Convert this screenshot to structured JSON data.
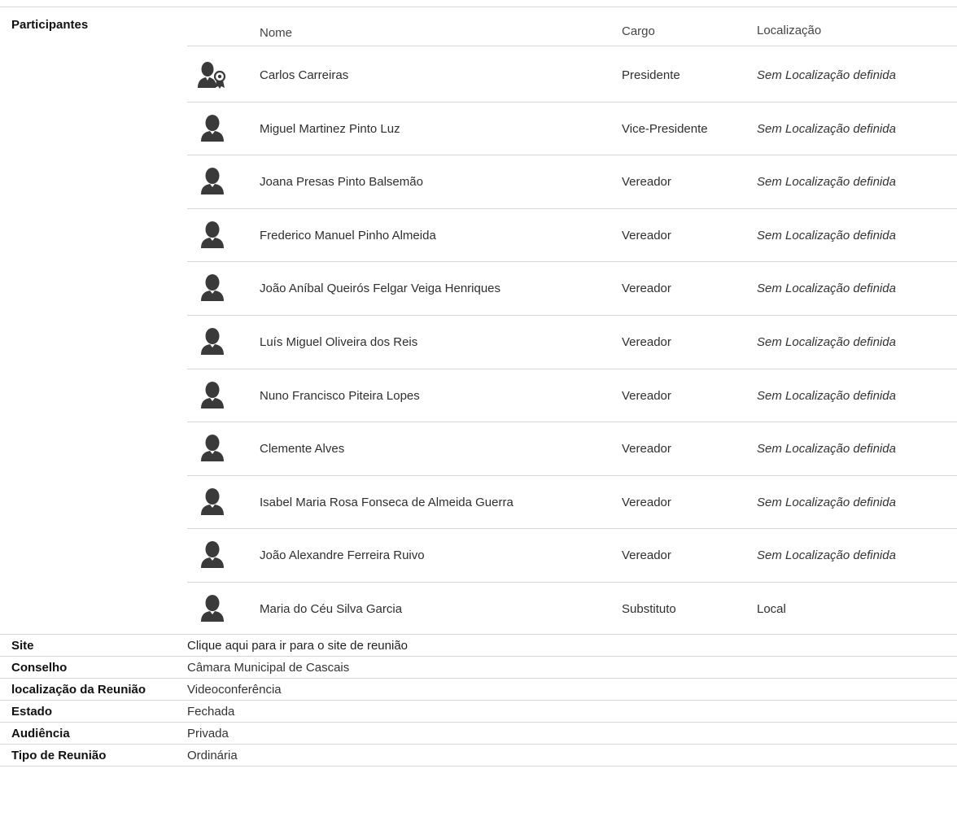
{
  "participants_section": {
    "label": "Participantes",
    "columns": {
      "name": "Nome",
      "role": "Cargo",
      "location": "Localização"
    },
    "rows": [
      {
        "name": "Carlos Carreiras",
        "role": "Presidente",
        "location": "Sem Localização definida",
        "icon": "president-icon"
      },
      {
        "name": "Miguel Martinez Pinto Luz",
        "role": "Vice-Presidente",
        "location": "Sem Localização definida",
        "icon": "person-icon"
      },
      {
        "name": "Joana Presas Pinto Balsemão",
        "role": "Vereador",
        "location": "Sem Localização definida",
        "icon": "person-icon"
      },
      {
        "name": "Frederico Manuel Pinho Almeida",
        "role": "Vereador",
        "location": "Sem Localização definida",
        "icon": "person-icon"
      },
      {
        "name": "João Aníbal Queirós Felgar Veiga Henriques",
        "role": "Vereador",
        "location": "Sem Localização definida",
        "icon": "person-icon"
      },
      {
        "name": "Luís Miguel Oliveira dos Reis",
        "role": "Vereador",
        "location": "Sem Localização definida",
        "icon": "person-icon"
      },
      {
        "name": "Nuno Francisco Piteira Lopes",
        "role": "Vereador",
        "location": "Sem Localização definida",
        "icon": "person-icon"
      },
      {
        "name": "Clemente Alves",
        "role": "Vereador",
        "location": "Sem Localização definida",
        "icon": "person-icon"
      },
      {
        "name": "Isabel Maria Rosa Fonseca de Almeida Guerra",
        "role": "Vereador",
        "location": "Sem Localização definida",
        "icon": "person-icon"
      },
      {
        "name": "João Alexandre Ferreira Ruivo",
        "role": "Vereador",
        "location": "Sem Localização definida",
        "icon": "person-icon"
      },
      {
        "name": "Maria do Céu Silva Garcia",
        "role": "Substituto",
        "location": "Local",
        "icon": "person-icon"
      }
    ]
  },
  "meeting_details": [
    {
      "label": "Site",
      "value": "Clique aqui para ir para o site de reunião"
    },
    {
      "label": "Conselho",
      "value": "Câmara Municipal de Cascais"
    },
    {
      "label": "localização da Reunião",
      "value": "Videoconferência"
    },
    {
      "label": "Estado",
      "value": "Fechada"
    },
    {
      "label": "Audiência",
      "value": "Privada"
    },
    {
      "label": "Tipo de Reunião",
      "value": "Ordinária"
    }
  ],
  "colors": {
    "divider": "#d6d6d6",
    "icon_fill": "#3a3a3a"
  }
}
